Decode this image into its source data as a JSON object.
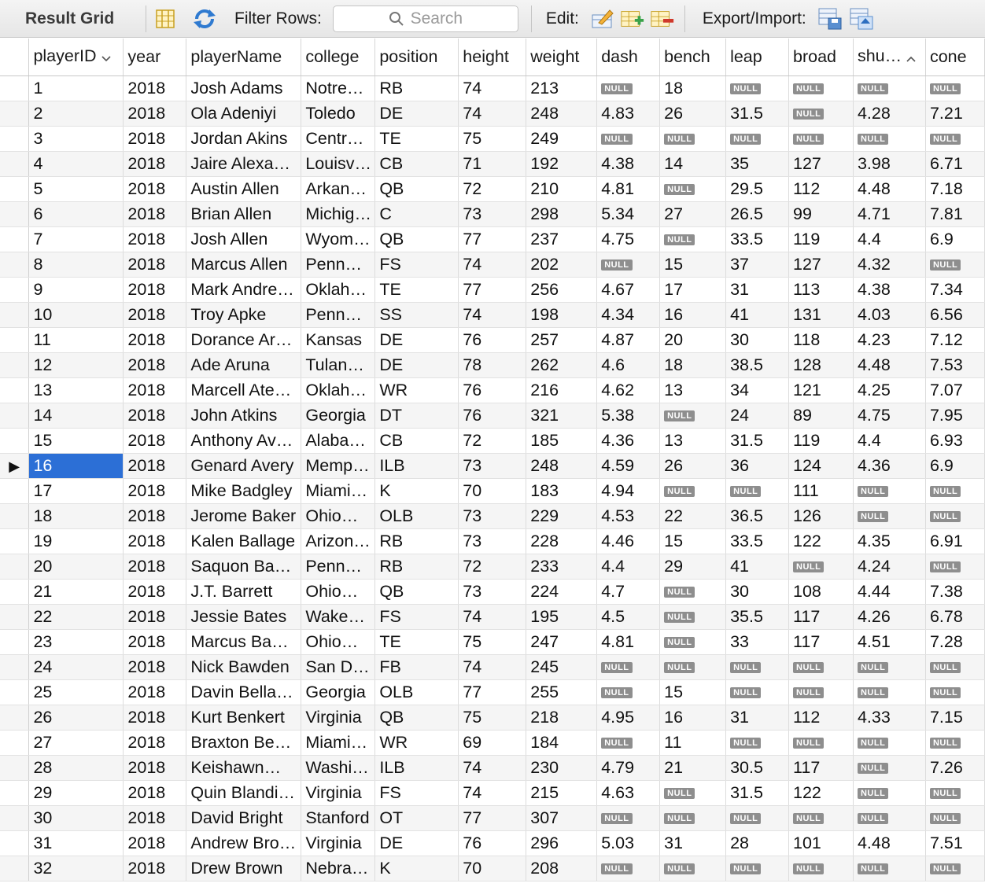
{
  "toolbar": {
    "title": "Result Grid",
    "filter_label": "Filter Rows:",
    "search_placeholder": "Search",
    "edit_label": "Edit:",
    "export_label": "Export/Import:"
  },
  "columns": [
    "playerID",
    "year",
    "playerName",
    "college",
    "position",
    "height",
    "weight",
    "dash",
    "bench",
    "leap",
    "broad",
    "shu…",
    "cone"
  ],
  "null_label": "NULL",
  "rows": [
    [
      "1",
      "2018",
      "Josh Adams",
      "Notre…",
      "RB",
      "74",
      "213",
      null,
      "18",
      null,
      null,
      null,
      null
    ],
    [
      "2",
      "2018",
      "Ola Adeniyi",
      "Toledo",
      "DE",
      "74",
      "248",
      "4.83",
      "26",
      "31.5",
      null,
      "4.28",
      "7.21"
    ],
    [
      "3",
      "2018",
      "Jordan Akins",
      "Centr…",
      "TE",
      "75",
      "249",
      null,
      null,
      null,
      null,
      null,
      null
    ],
    [
      "4",
      "2018",
      "Jaire Alexa…",
      "Louisv…",
      "CB",
      "71",
      "192",
      "4.38",
      "14",
      "35",
      "127",
      "3.98",
      "6.71"
    ],
    [
      "5",
      "2018",
      "Austin Allen",
      "Arkan…",
      "QB",
      "72",
      "210",
      "4.81",
      null,
      "29.5",
      "112",
      "4.48",
      "7.18"
    ],
    [
      "6",
      "2018",
      "Brian Allen",
      "Michig…",
      "C",
      "73",
      "298",
      "5.34",
      "27",
      "26.5",
      "99",
      "4.71",
      "7.81"
    ],
    [
      "7",
      "2018",
      "Josh Allen",
      "Wyom…",
      "QB",
      "77",
      "237",
      "4.75",
      null,
      "33.5",
      "119",
      "4.4",
      "6.9"
    ],
    [
      "8",
      "2018",
      "Marcus Allen",
      "Penn…",
      "FS",
      "74",
      "202",
      null,
      "15",
      "37",
      "127",
      "4.32",
      null
    ],
    [
      "9",
      "2018",
      "Mark Andre…",
      "Oklah…",
      "TE",
      "77",
      "256",
      "4.67",
      "17",
      "31",
      "113",
      "4.38",
      "7.34"
    ],
    [
      "10",
      "2018",
      "Troy Apke",
      "Penn…",
      "SS",
      "74",
      "198",
      "4.34",
      "16",
      "41",
      "131",
      "4.03",
      "6.56"
    ],
    [
      "11",
      "2018",
      "Dorance Ar…",
      "Kansas",
      "DE",
      "76",
      "257",
      "4.87",
      "20",
      "30",
      "118",
      "4.23",
      "7.12"
    ],
    [
      "12",
      "2018",
      "Ade Aruna",
      "Tulan…",
      "DE",
      "78",
      "262",
      "4.6",
      "18",
      "38.5",
      "128",
      "4.48",
      "7.53"
    ],
    [
      "13",
      "2018",
      "Marcell Ate…",
      "Oklah…",
      "WR",
      "76",
      "216",
      "4.62",
      "13",
      "34",
      "121",
      "4.25",
      "7.07"
    ],
    [
      "14",
      "2018",
      "John Atkins",
      "Georgia",
      "DT",
      "76",
      "321",
      "5.38",
      null,
      "24",
      "89",
      "4.75",
      "7.95"
    ],
    [
      "15",
      "2018",
      "Anthony Av…",
      "Alaba…",
      "CB",
      "72",
      "185",
      "4.36",
      "13",
      "31.5",
      "119",
      "4.4",
      "6.93"
    ],
    [
      "16",
      "2018",
      "Genard Avery",
      "Memp…",
      "ILB",
      "73",
      "248",
      "4.59",
      "26",
      "36",
      "124",
      "4.36",
      "6.9"
    ],
    [
      "17",
      "2018",
      "Mike Badgley",
      "Miami…",
      "K",
      "70",
      "183",
      "4.94",
      null,
      null,
      "111",
      null,
      null
    ],
    [
      "18",
      "2018",
      "Jerome Baker",
      "Ohio…",
      "OLB",
      "73",
      "229",
      "4.53",
      "22",
      "36.5",
      "126",
      null,
      null
    ],
    [
      "19",
      "2018",
      "Kalen Ballage",
      "Arizon…",
      "RB",
      "73",
      "228",
      "4.46",
      "15",
      "33.5",
      "122",
      "4.35",
      "6.91"
    ],
    [
      "20",
      "2018",
      "Saquon Ba…",
      "Penn…",
      "RB",
      "72",
      "233",
      "4.4",
      "29",
      "41",
      null,
      "4.24",
      null
    ],
    [
      "21",
      "2018",
      "J.T. Barrett",
      "Ohio…",
      "QB",
      "73",
      "224",
      "4.7",
      null,
      "30",
      "108",
      "4.44",
      "7.38"
    ],
    [
      "22",
      "2018",
      "Jessie Bates",
      "Wake…",
      "FS",
      "74",
      "195",
      "4.5",
      null,
      "35.5",
      "117",
      "4.26",
      "6.78"
    ],
    [
      "23",
      "2018",
      "Marcus Ba…",
      "Ohio…",
      "TE",
      "75",
      "247",
      "4.81",
      null,
      "33",
      "117",
      "4.51",
      "7.28"
    ],
    [
      "24",
      "2018",
      "Nick Bawden",
      "San D…",
      "FB",
      "74",
      "245",
      null,
      null,
      null,
      null,
      null,
      null
    ],
    [
      "25",
      "2018",
      "Davin Bella…",
      "Georgia",
      "OLB",
      "77",
      "255",
      null,
      "15",
      null,
      null,
      null,
      null
    ],
    [
      "26",
      "2018",
      "Kurt Benkert",
      "Virginia",
      "QB",
      "75",
      "218",
      "4.95",
      "16",
      "31",
      "112",
      "4.33",
      "7.15"
    ],
    [
      "27",
      "2018",
      "Braxton Be…",
      "Miami…",
      "WR",
      "69",
      "184",
      null,
      "11",
      null,
      null,
      null,
      null
    ],
    [
      "28",
      "2018",
      "Keishawn…",
      "Washi…",
      "ILB",
      "74",
      "230",
      "4.79",
      "21",
      "30.5",
      "117",
      null,
      "7.26"
    ],
    [
      "29",
      "2018",
      "Quin Blandi…",
      "Virginia",
      "FS",
      "74",
      "215",
      "4.63",
      null,
      "31.5",
      "122",
      null,
      null
    ],
    [
      "30",
      "2018",
      "David Bright",
      "Stanford",
      "OT",
      "77",
      "307",
      null,
      null,
      null,
      null,
      null,
      null
    ],
    [
      "31",
      "2018",
      "Andrew Bro…",
      "Virginia",
      "DE",
      "76",
      "296",
      "5.03",
      "31",
      "28",
      "101",
      "4.48",
      "7.51"
    ],
    [
      "32",
      "2018",
      "Drew Brown",
      "Nebra…",
      "K",
      "70",
      "208",
      null,
      null,
      null,
      null,
      null,
      null
    ]
  ],
  "selected_row": 15,
  "colors": {
    "selection": "#2c6fd6",
    "null_badge": "#8e8e8e"
  }
}
